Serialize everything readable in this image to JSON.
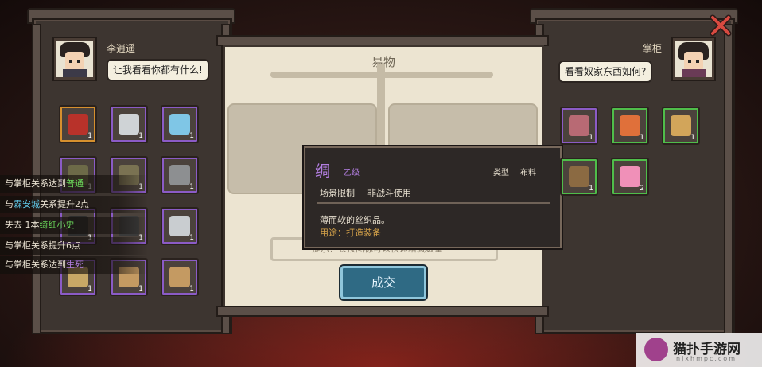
{
  "player": {
    "name": "李逍遥",
    "speech": "让我看看你都有什么!"
  },
  "merchant": {
    "name": "掌柜",
    "speech": "看看奴家东西如何?"
  },
  "trade": {
    "title": "易物",
    "confirm_label": "成交",
    "hint_text": "提示：长按图标可以快速增减数量"
  },
  "player_items": [
    {
      "qty": "1",
      "rarity": "orange",
      "icon": "treasure-chest-icon"
    },
    {
      "qty": "1",
      "rarity": "purple",
      "icon": "cleaver-icon"
    },
    {
      "qty": "1",
      "rarity": "purple",
      "icon": "jade-ring-icon"
    },
    {
      "qty": "1",
      "rarity": "purple",
      "icon": "teapot-icon"
    },
    {
      "qty": "1",
      "rarity": "purple",
      "icon": "armor-icon"
    },
    {
      "qty": "1",
      "rarity": "purple",
      "icon": "stone-icon"
    },
    {
      "qty": "1",
      "rarity": "purple",
      "icon": "ink-stick-icon"
    },
    {
      "qty": "1",
      "rarity": "purple",
      "icon": "ink-block-icon"
    },
    {
      "qty": "1",
      "rarity": "purple",
      "icon": "hairpin-icon"
    },
    {
      "qty": "1",
      "rarity": "purple",
      "icon": "flute-icon"
    },
    {
      "qty": "1",
      "rarity": "purple",
      "icon": "scroll-pattern-icon"
    },
    {
      "qty": "1",
      "rarity": "purple",
      "icon": "scroll-pattern-icon"
    }
  ],
  "merchant_items": [
    {
      "qty": "1",
      "rarity": "purple",
      "icon": "silk-cloth-icon"
    },
    {
      "qty": "1",
      "rarity": "green",
      "icon": "cake-plate-icon"
    },
    {
      "qty": "1",
      "rarity": "green",
      "icon": "book-icon"
    },
    {
      "qty": "1",
      "rarity": "green",
      "icon": "bamboo-basket-icon"
    },
    {
      "qty": "2",
      "rarity": "green",
      "icon": "pink-pastry-icon"
    }
  ],
  "tooltip": {
    "name": "绸",
    "grade": "乙级",
    "type_label": "类型",
    "type_value": "布料",
    "scene_label": "场景限制",
    "scene_value": "非战斗使用",
    "description": "薄而软的丝织品。",
    "usage": "用途：打造装备"
  },
  "logs": [
    {
      "prefix": "与掌柜关系达到",
      "value": "普通",
      "suffix": "",
      "color": "green"
    },
    {
      "prefix": "与",
      "value": "霖安城",
      "suffix": "关系提升2点",
      "color": "blue"
    },
    {
      "prefix": "失去 1本",
      "value": "绮红小史",
      "suffix": "",
      "color": "green"
    },
    {
      "prefix": "与掌柜关系提升6点",
      "value": "",
      "suffix": "",
      "color": "green"
    },
    {
      "prefix": "与掌柜关系达到",
      "value": "生死",
      "suffix": "",
      "color": "purple"
    }
  ],
  "watermark": {
    "title": "猫扑手游网",
    "subtitle": "njxhmpc.com"
  },
  "colors": {
    "purple": "#b27ee0",
    "green": "#4fbd4a",
    "orange": "#d6902e",
    "button": "#2f6a84"
  }
}
